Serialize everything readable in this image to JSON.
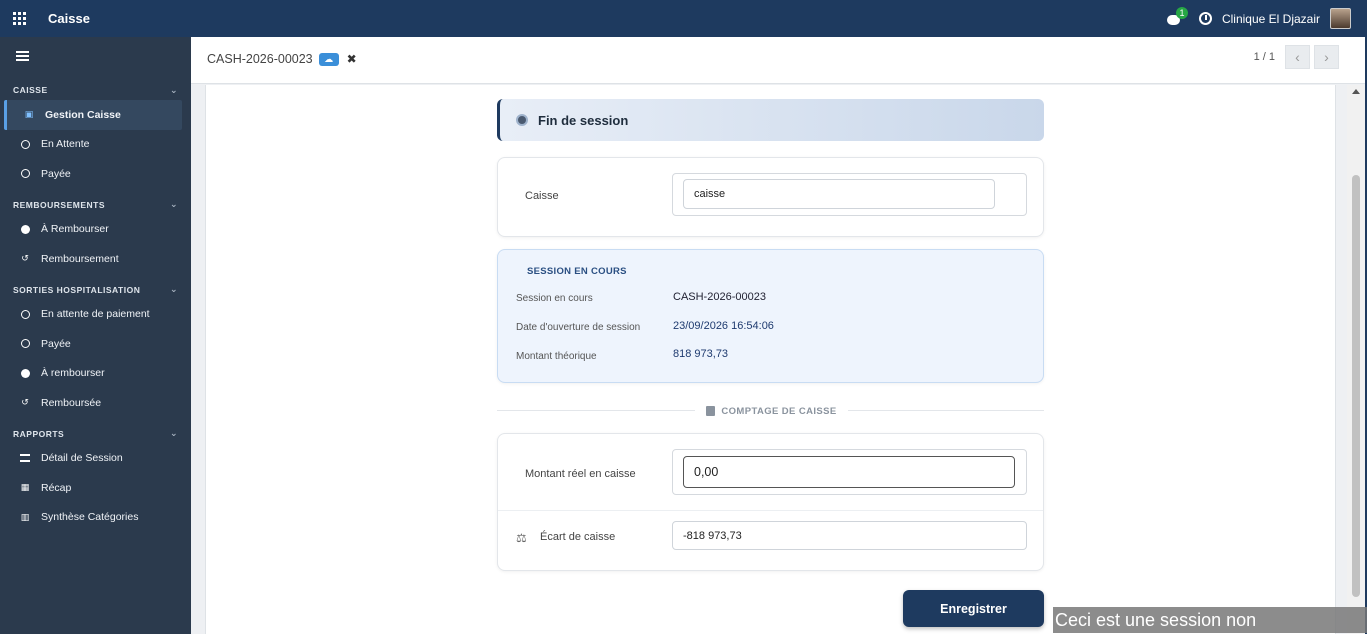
{
  "topbar": {
    "app_title": "Caisse",
    "chat_count": "1",
    "company": "Clinique El Djazair"
  },
  "sidebar": {
    "sections": [
      {
        "title": "CAISSE",
        "items": [
          {
            "label": "Gestion Caisse",
            "icon": "cash-icon",
            "active": true
          },
          {
            "label": "En Attente",
            "icon": "clock-icon"
          },
          {
            "label": "Payée",
            "icon": "check-circle-icon"
          }
        ]
      },
      {
        "title": "REMBOURSEMENTS",
        "items": [
          {
            "label": "À Rembourser",
            "icon": "info-icon"
          },
          {
            "label": "Remboursement",
            "icon": "undo-icon"
          }
        ]
      },
      {
        "title": "SORTIES HOSPITALISATION",
        "items": [
          {
            "label": "En attente de paiement",
            "icon": "clock-icon"
          },
          {
            "label": "Payée",
            "icon": "check-circle-icon"
          },
          {
            "label": "À rembourser",
            "icon": "info-icon"
          },
          {
            "label": "Remboursée",
            "icon": "undo-icon"
          }
        ]
      },
      {
        "title": "RAPPORTS",
        "items": [
          {
            "label": "Détail de Session",
            "icon": "list-icon"
          },
          {
            "label": "Récap",
            "icon": "table-icon"
          },
          {
            "label": "Synthèse Catégories",
            "icon": "bar-chart-icon"
          }
        ]
      }
    ]
  },
  "control_panel": {
    "record_name": "CASH-2026-00023",
    "pager": "1 / 1"
  },
  "form": {
    "header": "Fin de session",
    "caisse_label": "Caisse",
    "caisse_value": "caisse",
    "session": {
      "title": "SESSION EN COURS",
      "rows": [
        {
          "label": "Session en cours",
          "value": "CASH-2026-00023"
        },
        {
          "label": "Date d'ouverture de session",
          "value": "23/09/2026 16:54:06"
        },
        {
          "label": "Montant théorique",
          "value": "818 973,73"
        }
      ]
    },
    "comptage_label": "COMPTAGE DE CAISSE",
    "montant_reel_label": "Montant réel en caisse",
    "montant_reel_value": "0,00",
    "ecart_label": "Écart de caisse",
    "ecart_value": "-818 973,73",
    "save_label": "Enregistrer"
  },
  "watermark": "Ceci est une session non commerciale."
}
